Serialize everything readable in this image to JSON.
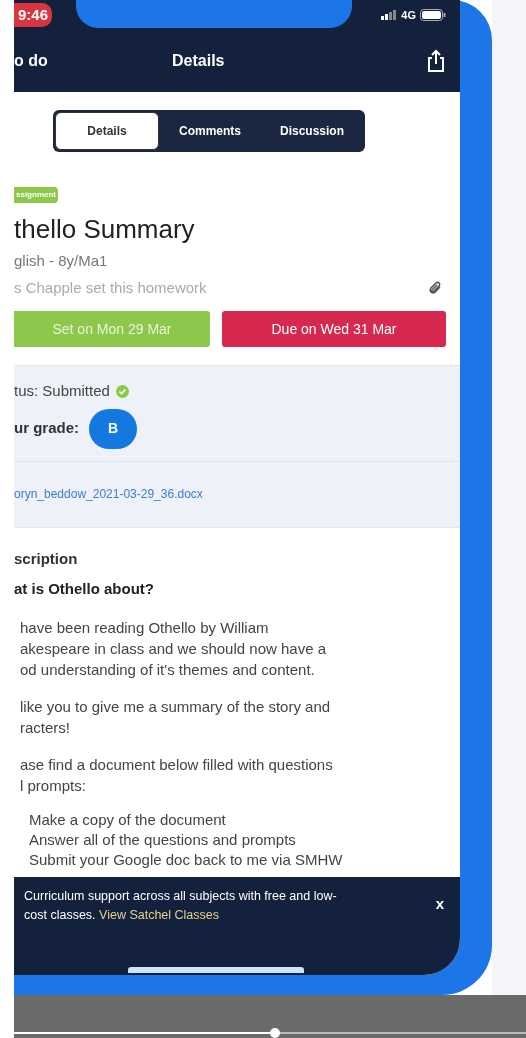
{
  "status_bar": {
    "time": "9:46",
    "network": "4G"
  },
  "nav": {
    "back": "o do",
    "title": "Details"
  },
  "tabs": [
    {
      "label": "Details",
      "selected": true
    },
    {
      "label": "Comments",
      "selected": false
    },
    {
      "label": "Discussion",
      "selected": false
    }
  ],
  "badge": "ssignment",
  "title": "thello Summary",
  "subject": "glish - 8y/Ma1",
  "setter": "s Chapple set this homework",
  "dates": [
    {
      "kind": "set",
      "label": "Set on Mon 29 Mar"
    },
    {
      "kind": "due",
      "label": "Due on Wed 31 Mar"
    }
  ],
  "status": {
    "label": "tus: Submitted",
    "submitted": true
  },
  "grade": {
    "label": "ur grade:",
    "value": "B"
  },
  "attachment": "oryn_beddow_2021-03-29_36.docx",
  "description": {
    "heading": "scription",
    "question": "at is Othello about?",
    "paragraphs": [
      [
        "have been reading Othello by William",
        "akespeare in class and we should now have a",
        "od understanding of it's themes and content."
      ],
      [
        "like you to give me a summary of the story and",
        "racters!"
      ],
      [
        "ase find a document below filled with questions",
        "l prompts:"
      ]
    ],
    "steps": [
      "Make a copy of the document",
      "Answer all of the questions and prompts",
      "Submit your Google doc back to me via SMHW"
    ]
  },
  "banner": {
    "text": "Curriculum support across all subjects with free and low-cost classes.",
    "link": "View Satchel Classes",
    "close": "x"
  },
  "video": {
    "level": 0.51
  }
}
